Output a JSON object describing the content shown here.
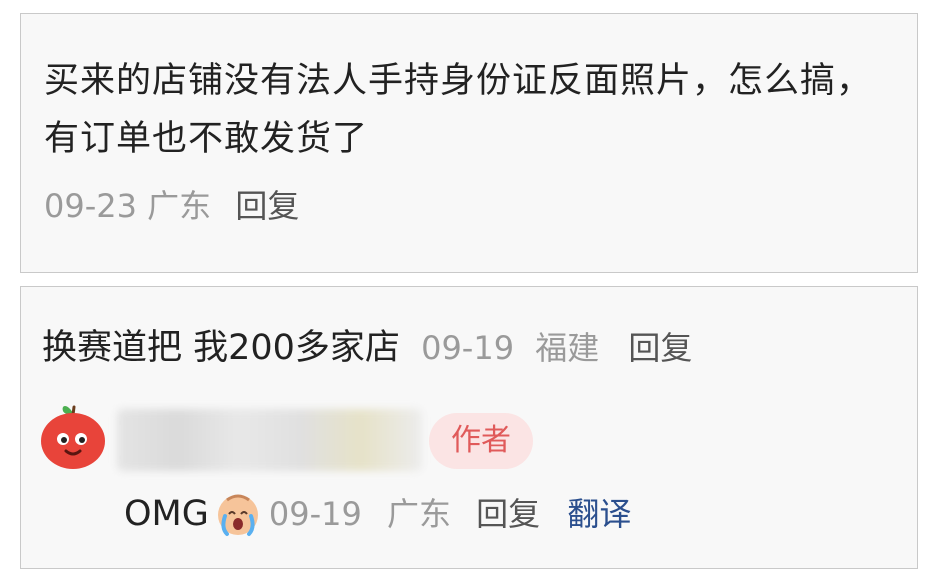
{
  "comment1": {
    "text": "买来的店铺没有法人手持身份证反面照片，怎么搞，有订单也不敢发货了",
    "date": "09-23",
    "location": "广东",
    "reply_label": "回复"
  },
  "comment2": {
    "text": "换赛道把 我200多家店",
    "date": "09-19",
    "location": "福建",
    "reply_label": "回复",
    "reply_thread": {
      "author_badge": "作者",
      "text": "OMG",
      "emoji": "crying-baby-emoji",
      "date": "09-19",
      "location": "广东",
      "reply_label": "回复",
      "translate_label": "翻译"
    }
  },
  "colors": {
    "meta_gray": "#9a9a9a",
    "badge_bg": "#fbe4e4",
    "badge_text": "#e05a5a",
    "translate_link": "#2b4f8e"
  }
}
